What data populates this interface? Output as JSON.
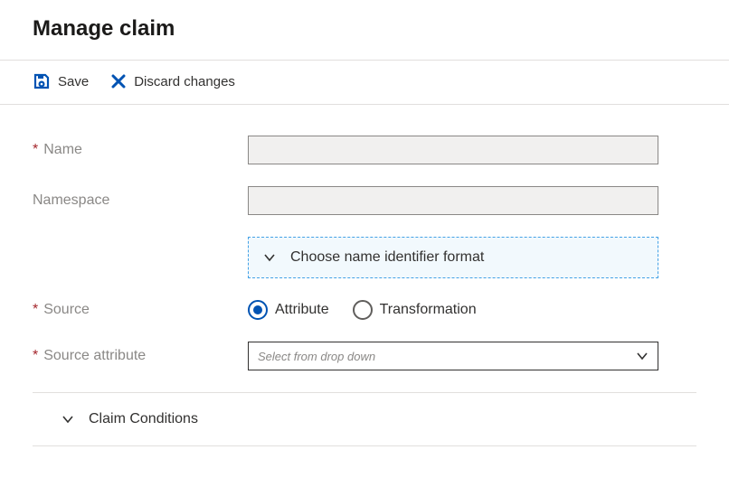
{
  "header": {
    "title": "Manage claim"
  },
  "toolbar": {
    "save_label": "Save",
    "discard_label": "Discard changes"
  },
  "form": {
    "name": {
      "label": "Name",
      "required": true,
      "value": ""
    },
    "namespace": {
      "label": "Namespace",
      "required": false,
      "value": ""
    },
    "identifier_expander": {
      "label": "Choose name identifier format"
    },
    "source": {
      "label": "Source",
      "required": true,
      "options": [
        "Attribute",
        "Transformation"
      ],
      "selected": "Attribute"
    },
    "source_attribute": {
      "label": "Source attribute",
      "required": true,
      "placeholder": "Select from drop down",
      "value": ""
    }
  },
  "sections": {
    "claim_conditions": {
      "label": "Claim Conditions",
      "expanded": false
    }
  },
  "required_marker": "*"
}
